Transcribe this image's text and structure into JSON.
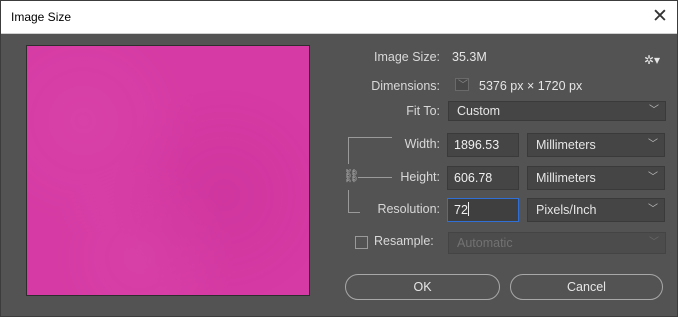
{
  "window": {
    "title": "Image Size",
    "close_icon": "close-icon"
  },
  "preview": {
    "color": "#d63aa4"
  },
  "info": {
    "image_size_label": "Image Size:",
    "image_size_value": "35.3M",
    "dimensions_label": "Dimensions:",
    "dimensions_value": "5376 px  ×  1720 px",
    "gear_icon": "gear-icon"
  },
  "fit_to": {
    "label": "Fit To:",
    "value": "Custom"
  },
  "width": {
    "label": "Width:",
    "value": "1896.53",
    "unit": "Millimeters"
  },
  "height": {
    "label": "Height:",
    "value": "606.78",
    "unit": "Millimeters"
  },
  "resolution": {
    "label": "Resolution:",
    "value": "72",
    "unit": "Pixels/Inch"
  },
  "resample": {
    "label": "Resample:",
    "checked": false,
    "value": "Automatic"
  },
  "buttons": {
    "ok": "OK",
    "cancel": "Cancel"
  },
  "colors": {
    "accent_focus": "#2f6fd6",
    "dialog_bg": "#535353"
  }
}
